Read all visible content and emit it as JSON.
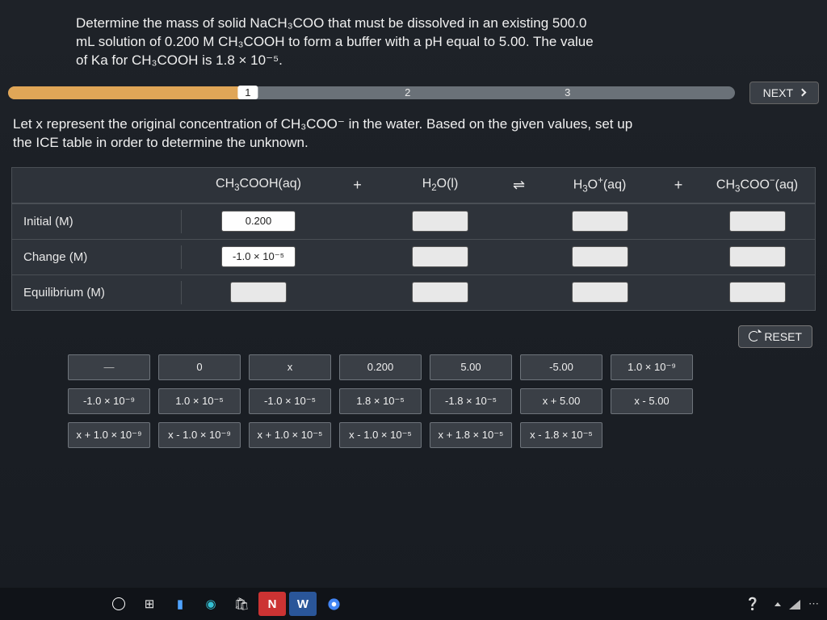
{
  "question": {
    "line1": "Determine the mass of solid NaCH₃COO that must be dissolved in an existing 500.0",
    "line2": "mL solution of 0.200 M CH₃COOH to form a buffer with a pH equal to 5.00. The value",
    "line3": "of Ka for CH₃COOH is 1.8 × 10⁻⁵."
  },
  "steps": [
    "1",
    "2",
    "3"
  ],
  "buttons": {
    "next": "NEXT",
    "reset": "RESET"
  },
  "instruction": {
    "line1": "Let x represent the original concentration of CH₃COO⁻ in the water. Based on the given values, set up",
    "line2": "the ICE table in order to determine the unknown."
  },
  "ice": {
    "species": [
      "CH₃COOH(aq)",
      "H₂O(l)",
      "H₃O⁺(aq)",
      "CH₃COO⁻(aq)"
    ],
    "operators": [
      "+",
      "⇌",
      "+"
    ],
    "rows": [
      "Initial (M)",
      "Change (M)",
      "Equilibrium (M)"
    ],
    "filled": {
      "initial_acid": "0.200",
      "change_acid": "-1.0 × 10⁻⁵"
    }
  },
  "tiles": [
    "—",
    "0",
    "x",
    "0.200",
    "5.00",
    "-5.00",
    "1.0 × 10⁻⁹",
    "-1.0 × 10⁻⁹",
    "1.0 × 10⁻⁵",
    "-1.0 × 10⁻⁵",
    "1.8 × 10⁻⁵",
    "-1.8 × 10⁻⁵",
    "x + 5.00",
    "x - 5.00",
    "x + 1.0 × 10⁻⁹",
    "x - 1.0 × 10⁻⁹",
    "x + 1.0 × 10⁻⁵",
    "x - 1.0 × 10⁻⁵",
    "x + 1.8 × 10⁻⁵",
    "x - 1.8 × 10⁻⁵"
  ]
}
